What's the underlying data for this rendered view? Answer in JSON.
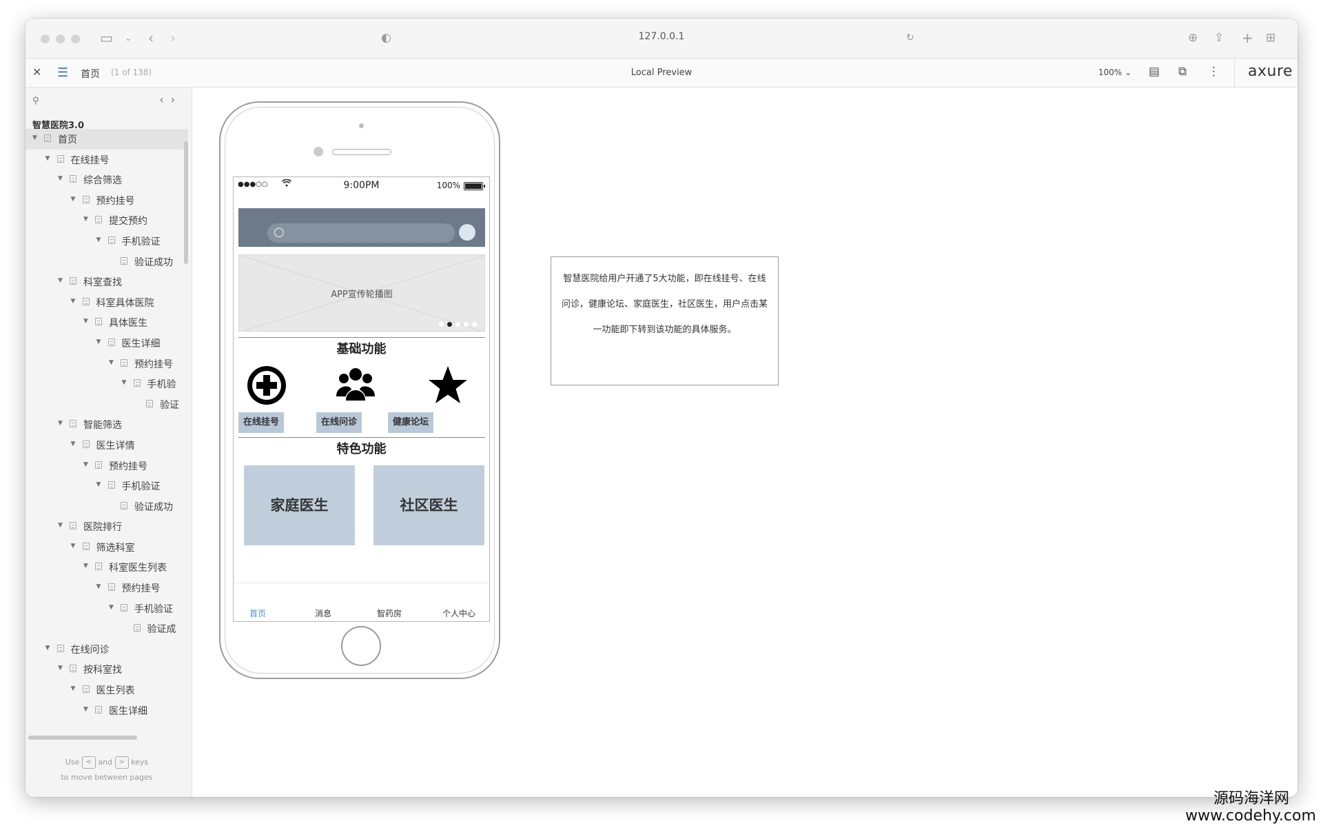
{
  "browser": {
    "url": "127.0.0.1"
  },
  "toolbar": {
    "page_name": "首页",
    "page_count": "(1 of 138)",
    "title": "Local Preview",
    "zoom": "100%",
    "brand": "axure"
  },
  "sidebar": {
    "project_name": "智慧医院3.0",
    "items": [
      {
        "label": "首页",
        "depth": 0,
        "expanded": true,
        "selected": true
      },
      {
        "label": "在线挂号",
        "depth": 1,
        "expanded": true
      },
      {
        "label": "综合筛选",
        "depth": 2,
        "expanded": true
      },
      {
        "label": "预约挂号",
        "depth": 3,
        "expanded": true
      },
      {
        "label": "提交预约",
        "depth": 4,
        "expanded": true
      },
      {
        "label": "手机验证",
        "depth": 5,
        "expanded": true
      },
      {
        "label": "验证成功",
        "depth": 6,
        "expanded": false
      },
      {
        "label": "科室查找",
        "depth": 2,
        "expanded": true
      },
      {
        "label": "科室具体医院",
        "depth": 3,
        "expanded": true
      },
      {
        "label": "具体医生",
        "depth": 4,
        "expanded": true
      },
      {
        "label": "医生详细",
        "depth": 5,
        "expanded": true
      },
      {
        "label": "预约挂号",
        "depth": 6,
        "expanded": true
      },
      {
        "label": "手机验",
        "depth": 7,
        "expanded": true
      },
      {
        "label": "验证",
        "depth": 8,
        "expanded": false
      },
      {
        "label": "智能筛选",
        "depth": 2,
        "expanded": true
      },
      {
        "label": "医生详情",
        "depth": 3,
        "expanded": true
      },
      {
        "label": "预约挂号",
        "depth": 4,
        "expanded": true
      },
      {
        "label": "手机验证",
        "depth": 5,
        "expanded": true
      },
      {
        "label": "验证成功",
        "depth": 6,
        "expanded": false
      },
      {
        "label": "医院排行",
        "depth": 2,
        "expanded": true
      },
      {
        "label": "筛选科室",
        "depth": 3,
        "expanded": true
      },
      {
        "label": "科室医生列表",
        "depth": 4,
        "expanded": true
      },
      {
        "label": "预约挂号",
        "depth": 5,
        "expanded": true
      },
      {
        "label": "手机验证",
        "depth": 6,
        "expanded": true
      },
      {
        "label": "验证成",
        "depth": 7,
        "expanded": false
      },
      {
        "label": "在线问诊",
        "depth": 1,
        "expanded": true
      },
      {
        "label": "按科室找",
        "depth": 2,
        "expanded": true
      },
      {
        "label": "医生列表",
        "depth": 3,
        "expanded": true
      },
      {
        "label": "医生详细",
        "depth": 4,
        "expanded": true
      }
    ],
    "hint_use": "Use",
    "hint_and": "and",
    "hint_keys": "keys",
    "hint_line2": "to move between pages",
    "key_left": "<",
    "key_right": ">"
  },
  "phone": {
    "status": {
      "signal": "●●●○○",
      "time": "9:00PM",
      "battery": "100%"
    },
    "banner_text": "APP宣传轮播图",
    "carousel": {
      "count": 5,
      "active": 1
    },
    "basic_title": "基础功能",
    "basic_functions": [
      {
        "label": "在线挂号",
        "icon": "plus-circle-icon"
      },
      {
        "label": "在线问诊",
        "icon": "group-icon"
      },
      {
        "label": "健康论坛",
        "icon": "star-icon"
      }
    ],
    "featured_title": "特色功能",
    "featured": [
      "家庭医生",
      "社区医生"
    ],
    "tabs": [
      {
        "label": "首页",
        "active": true
      },
      {
        "label": "消息",
        "active": false
      },
      {
        "label": "智药房",
        "active": false
      },
      {
        "label": "个人中心",
        "active": false
      }
    ]
  },
  "note": {
    "line1": "智慧医院给用户开通了5大功能，即在线挂号、在线",
    "line2": "问诊，健康论坛、家庭医生，社区医生，用户点击某",
    "line3": "一功能即下转到该功能的具体服务。"
  },
  "watermark": {
    "line1": "源码海洋网",
    "line2": "www.codehy.com"
  },
  "colors": {
    "accent": "#4a90e2",
    "search_band": "#6c7a89",
    "button_fill": "#b8c8d8"
  }
}
